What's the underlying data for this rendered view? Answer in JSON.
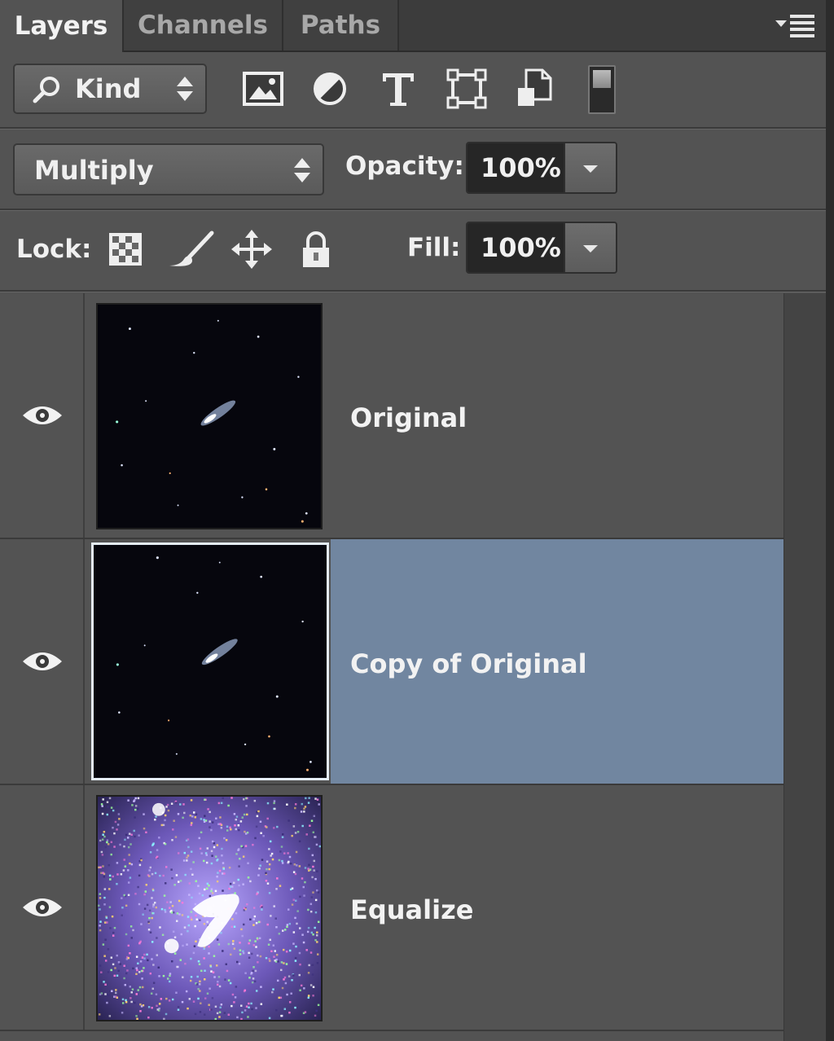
{
  "tabs": [
    {
      "label": "Layers",
      "active": true
    },
    {
      "label": "Channels",
      "active": false
    },
    {
      "label": "Paths",
      "active": false
    }
  ],
  "filter": {
    "kind_label": "Kind",
    "icons": [
      "image-filter-icon",
      "adjustment-filter-icon",
      "type-filter-icon",
      "shape-filter-icon",
      "smart-object-filter-icon"
    ]
  },
  "blend": {
    "mode": "Multiply",
    "opacity_label": "Opacity:",
    "opacity_value": "100%"
  },
  "lock": {
    "label": "Lock:",
    "icons": [
      "lock-transparent-pixels-icon",
      "lock-image-pixels-icon",
      "lock-position-icon",
      "lock-all-icon"
    ],
    "fill_label": "Fill:",
    "fill_value": "100%"
  },
  "layers": [
    {
      "name": "Original",
      "visible": true,
      "selected": false
    },
    {
      "name": "Copy of Original",
      "visible": true,
      "selected": true
    },
    {
      "name": "Equalize",
      "visible": true,
      "selected": false
    }
  ],
  "colors": {
    "panel_bg": "#535353",
    "selection": "#7186a0"
  }
}
